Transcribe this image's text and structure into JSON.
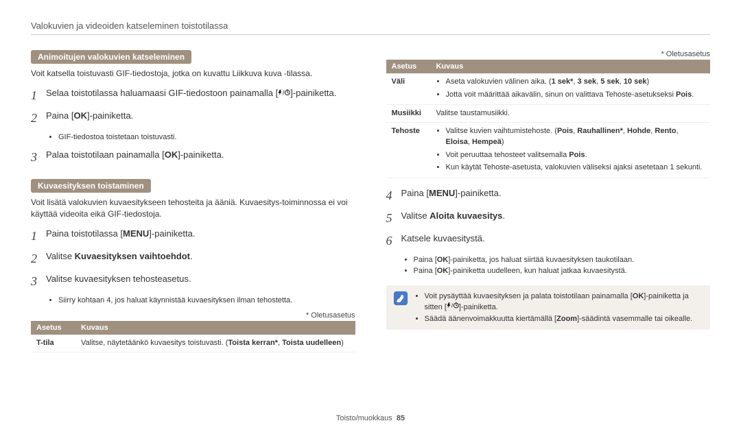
{
  "header": "Valokuvien ja videoiden katseleminen toistotilassa",
  "left": {
    "section1_label": "Animoitujen valokuvien katseleminen",
    "section1_intro": "Voit katsella toistuvasti GIF-tiedostoja, jotka on kuvattu Liikkuva kuva -tilassa.",
    "steps1": [
      {
        "num": "1",
        "text_a": "Selaa toistotilassa haluamaasi GIF-tiedostoon painamalla [",
        "text_b": "]-painiketta."
      },
      {
        "num": "2",
        "text_a": "Paina [",
        "ok": true,
        "text_b": "]-painiketta.",
        "bullets": [
          "GIF-tiedostoa toistetaan toistuvasti."
        ]
      },
      {
        "num": "3",
        "text_a": "Palaa toistotilaan painamalla [",
        "ok": true,
        "text_b": "]-painiketta."
      }
    ],
    "section2_label": "Kuvaesityksen toistaminen",
    "section2_intro": "Voit lisätä valokuvien kuvaesitykseen tehosteita ja ääniä. Kuvaesitys-toiminnossa ei voi käyttää videoita eikä GIF-tiedostoja.",
    "steps2": [
      {
        "num": "1",
        "text_a": "Paina toistotilassa [",
        "menu": true,
        "text_b": "]-painiketta."
      },
      {
        "num": "2",
        "full": {
          "pre": "Valitse ",
          "strong": "Kuvaesityksen vaihtoehdot",
          "post": "."
        }
      },
      {
        "num": "3",
        "plain": "Valitse kuvaesityksen tehosteasetus.",
        "bullets": [
          "Siirry kohtaan 4, jos haluat käynnistää kuvaesityksen ilman tehostetta."
        ]
      }
    ],
    "default_note": "* Oletusasetus",
    "table_headers": [
      "Asetus",
      "Kuvaus"
    ],
    "table_rows": [
      {
        "setting": "T-tila",
        "desc_pre": "Valitse, näytetäänkö kuvaesitys toistuvasti. (",
        "desc_strong": "Toista kerran*",
        "desc_mid": ", ",
        "desc_strong2": "Toista uudelleen",
        "desc_post": ")"
      }
    ]
  },
  "right": {
    "default_note": "* Oletusasetus",
    "table_headers": [
      "Asetus",
      "Kuvaus"
    ],
    "rows": {
      "vali": {
        "setting": "Väli",
        "b1_pre": "Aseta valokuvien välinen aika. (",
        "b1_strong": "1 sek*",
        "b1_mid": ", ",
        "b1_strong2": "3 sek",
        "b1_mid2": ", ",
        "b1_strong3": "5 sek",
        "b1_mid3": ", ",
        "b1_strong4": "10 sek",
        "b1_post": ")",
        "b2_pre": "Jotta voit määrittää aikavälin, sinun on valittava Tehoste-asetukseksi ",
        "b2_strong": "Pois",
        "b2_post": "."
      },
      "musiikki": {
        "setting": "Musiikki",
        "desc": "Valitse taustamusiikki."
      },
      "tehoste": {
        "setting": "Tehoste",
        "b1_pre": "Valitse kuvien vaihtumistehoste. (",
        "b1_strong": "Pois",
        "b1_m1": ", ",
        "b1_s2": "Rauhallinen*",
        "b1_m2": ", ",
        "b1_s3": "Hohde",
        "b1_m3": ", ",
        "b1_s4": "Rento",
        "b1_m4": ", ",
        "b1_s5": "Eloisa",
        "b1_m5": ", ",
        "b1_s6": "Hempeä",
        "b1_post": ")",
        "b2_pre": "Voit peruuttaa tehosteet valitsemalla ",
        "b2_strong": "Pois",
        "b2_post": ".",
        "b3": "Kun käytät Tehoste-asetusta, valokuvien väliseksi ajaksi asetetaan 1 sekunti."
      }
    },
    "steps": [
      {
        "num": "4",
        "text_a": "Paina [",
        "menu": true,
        "text_b": "]-painiketta."
      },
      {
        "num": "5",
        "full": {
          "pre": "Valitse ",
          "strong": "Aloita kuvaesitys",
          "post": "."
        }
      },
      {
        "num": "6",
        "plain": "Katsele kuvaesitystä.",
        "bullets_ok": true,
        "b1_a": "Paina [",
        "b1_b": "]-painiketta, jos haluat siirtää kuvaesityksen taukotilaan.",
        "b2_a": "Paina [",
        "b2_b": "]-painiketta uudelleen, kun haluat jatkaa kuvaesitystä."
      }
    ],
    "note": {
      "n1_a": "Voit pysäyttää kuvaesityksen ja palata toistotilaan painamalla [",
      "n1_b": "]-painiketta ja sitten [",
      "n1_c": "]-painiketta.",
      "n2_a": "Säädä äänenvoimakkuutta kiertämällä [",
      "n2_strong": "Zoom",
      "n2_b": "]-säädintä vasemmalle tai oikealle."
    }
  },
  "footer": {
    "label": "Toisto/muokkaus",
    "page": "85"
  }
}
